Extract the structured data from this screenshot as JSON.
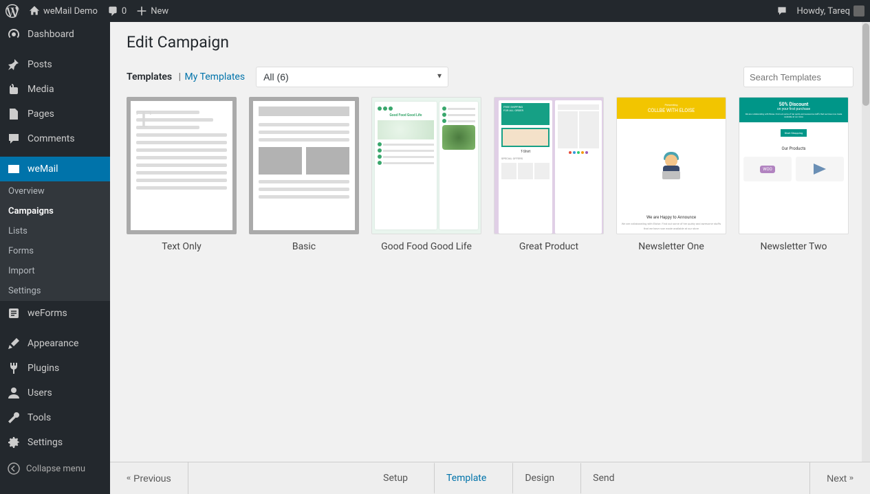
{
  "adminBar": {
    "siteName": "weMail Demo",
    "commentsCount": "0",
    "newLabel": "New",
    "greeting": "Howdy, Tareq"
  },
  "sidebar": {
    "items": [
      {
        "label": "Dashboard",
        "icon": "dashboard"
      },
      {
        "label": "Posts",
        "icon": "pin"
      },
      {
        "label": "Media",
        "icon": "media"
      },
      {
        "label": "Pages",
        "icon": "page"
      },
      {
        "label": "Comments",
        "icon": "comment"
      },
      {
        "label": "weMail",
        "icon": "mail",
        "active": true
      },
      {
        "label": "weForms",
        "icon": "forms"
      },
      {
        "label": "Appearance",
        "icon": "brush"
      },
      {
        "label": "Plugins",
        "icon": "plug"
      },
      {
        "label": "Users",
        "icon": "user"
      },
      {
        "label": "Tools",
        "icon": "wrench"
      },
      {
        "label": "Settings",
        "icon": "gear"
      }
    ],
    "submenu": [
      {
        "label": "Overview"
      },
      {
        "label": "Campaigns",
        "active": true
      },
      {
        "label": "Lists"
      },
      {
        "label": "Forms"
      },
      {
        "label": "Import"
      },
      {
        "label": "Settings"
      }
    ],
    "collapseLabel": "Collapse menu"
  },
  "page": {
    "title": "Edit Campaign",
    "tabs": {
      "templates": "Templates",
      "myTemplates": "My Templates"
    },
    "filterLabel": "All (6)",
    "searchPlaceholder": "Search Templates"
  },
  "templates": [
    {
      "title": "Text Only",
      "kind": "textOnly"
    },
    {
      "title": "Basic",
      "kind": "basic"
    },
    {
      "title": "Good Food Good Life",
      "kind": "goodfood",
      "heroText": "Good Food Good Life"
    },
    {
      "title": "Great Product",
      "kind": "greatprod",
      "heroText": "FREE SHIPPING",
      "heroSub": "FOR ALL ORDER",
      "badge": "T-Shirt",
      "section": "SPECIAL OFFERS"
    },
    {
      "title": "Newsletter One",
      "kind": "nl1",
      "presenting": "Presenting",
      "headline": "COLLBE WITH ELOISE",
      "announce": "We are Happy to Announce",
      "body": "We are collaborating with Eloise. Find out some of her quirky and awesome stuffs that we have now made available at our store"
    },
    {
      "title": "Newsletter Two",
      "kind": "nl2",
      "disc": "50% Discount",
      "sub": "on your first purchase",
      "body": "We are collaborating with Eloise. Find out some of her quirky and awesome stuffs that we have now made available at our store",
      "btn": "Start Shopping",
      "h2": "Our Products",
      "woo": "WOO"
    }
  ],
  "stepper": {
    "prev": "Previous",
    "next": "Next",
    "steps": [
      {
        "label": "Setup"
      },
      {
        "label": "Template",
        "active": true
      },
      {
        "label": "Design"
      },
      {
        "label": "Send"
      }
    ]
  }
}
